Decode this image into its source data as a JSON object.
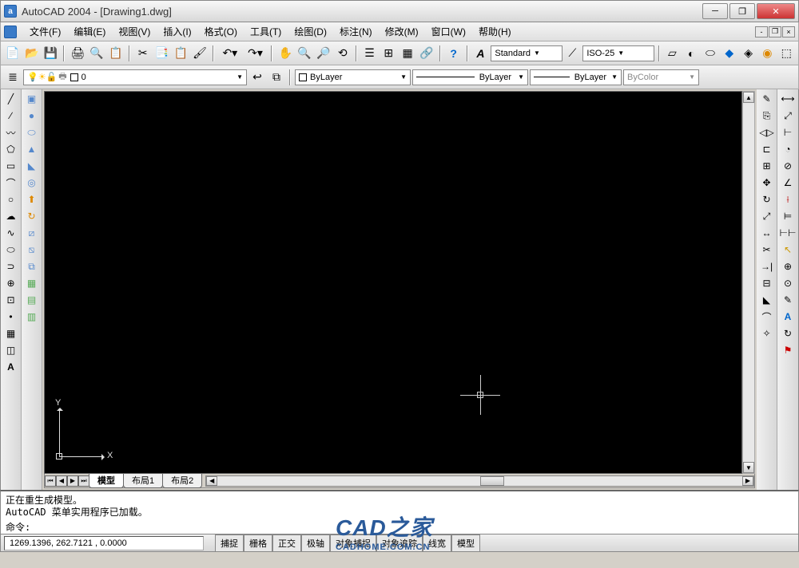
{
  "title": "AutoCAD 2004 - [Drawing1.dwg]",
  "app_icon_letter": "a",
  "menu": [
    "文件(F)",
    "编辑(E)",
    "视图(V)",
    "插入(I)",
    "格式(O)",
    "工具(T)",
    "绘图(D)",
    "标注(N)",
    "修改(M)",
    "窗口(W)",
    "帮助(H)"
  ],
  "toolbar1": {
    "style_label": "Standard",
    "dimstyle_label": "ISO-25"
  },
  "layer_row": {
    "layer_name": "0",
    "color_label": "ByLayer",
    "linetype_label": "ByLayer",
    "lineweight_label": "ByLayer",
    "plotstyle_label": "ByColor"
  },
  "ucs": {
    "x": "X",
    "y": "Y"
  },
  "tabs": {
    "model": "模型",
    "layout1": "布局1",
    "layout2": "布局2"
  },
  "command": {
    "line1": "正在重生成模型。",
    "line2": "AutoCAD 菜单实用程序已加载。",
    "prompt": "命令:"
  },
  "status": {
    "coords": "1269.1396, 262.7121 , 0.0000",
    "buttons": [
      "捕捉",
      "栅格",
      "正交",
      "极轴",
      "对象捕捉",
      "对象追踪",
      "线宽",
      "模型"
    ]
  },
  "watermark": {
    "big": "CAD之家",
    "small": "CADHOME.COM.CN"
  }
}
